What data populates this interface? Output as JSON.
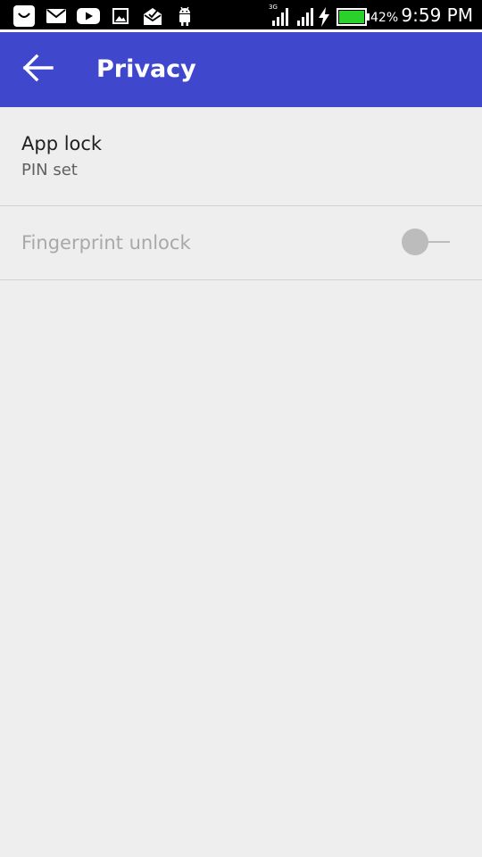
{
  "status_bar": {
    "icons": [
      "shopping-bag-icon",
      "mail-icon",
      "youtube-icon",
      "image-icon",
      "mail-open-icon",
      "android-icon",
      "signal-icon",
      "signal-icon",
      "charging-icon",
      "battery-icon"
    ],
    "network_label": "3G",
    "battery_percent": "42%",
    "time": "9:59 PM",
    "battery_color": "#2bd12b"
  },
  "app_bar": {
    "title": "Privacy",
    "background_color": "#3f48cc",
    "back_icon": "arrow-left-icon"
  },
  "settings": {
    "items": [
      {
        "title": "App lock",
        "summary": "PIN set"
      },
      {
        "title": "Fingerprint unlock",
        "enabled": false,
        "toggle_on": false
      }
    ]
  }
}
